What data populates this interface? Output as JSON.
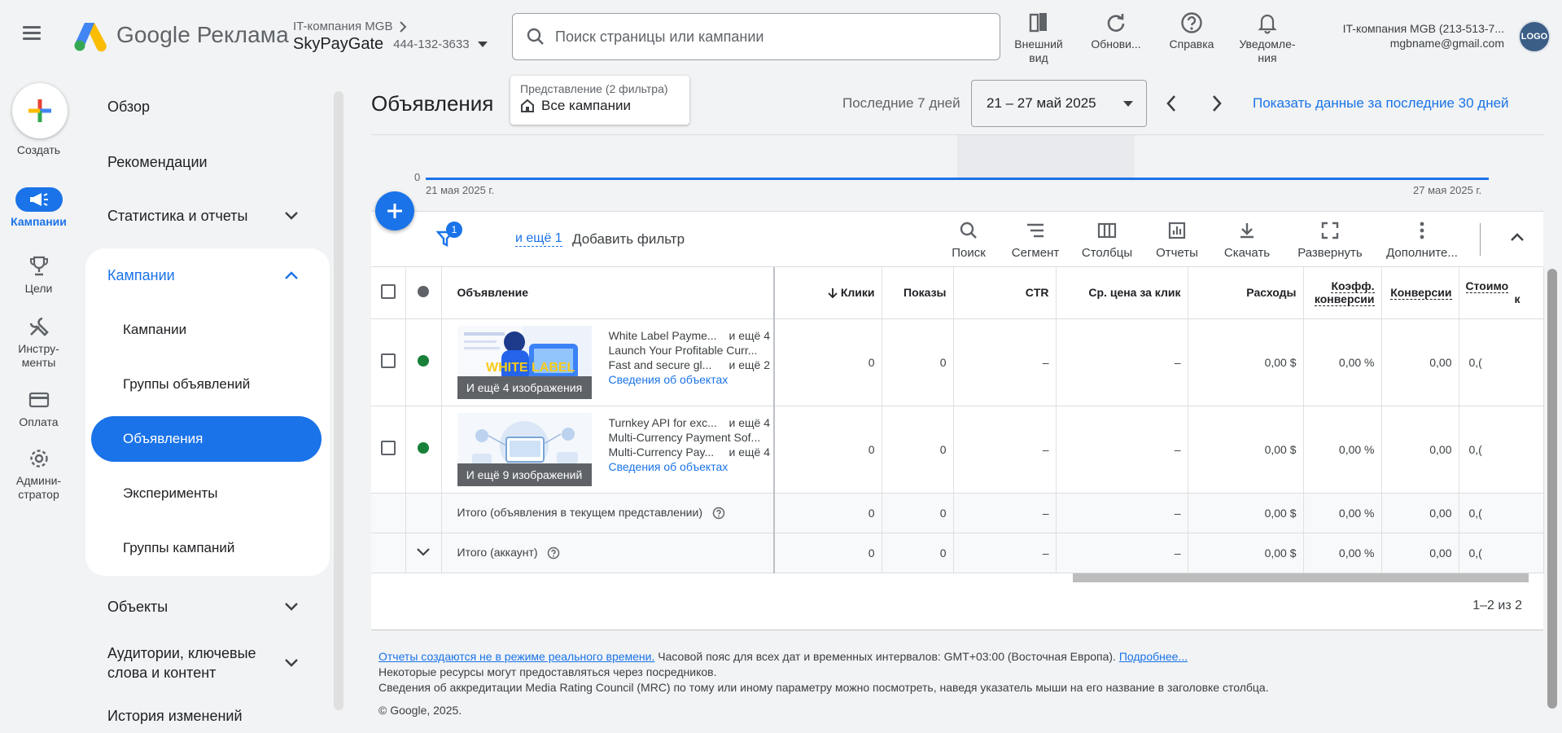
{
  "header": {
    "product": "Google Реклама",
    "account_company": "IT-компания MGB",
    "account_name": "SkyPayGate",
    "account_id": "444-132-3633",
    "search_placeholder": "Поиск страницы или кампании",
    "tools": [
      {
        "label1": "Внешний",
        "label2": "вид",
        "icon": "appearance-icon"
      },
      {
        "label1": "Обнови...",
        "label2": "",
        "icon": "refresh-icon"
      },
      {
        "label1": "Справка",
        "label2": "",
        "icon": "help-icon"
      },
      {
        "label1": "Уведомле-",
        "label2": "ния",
        "icon": "bell-icon"
      }
    ],
    "user_line1": "IT-компания MGB (213-513-7...",
    "user_line2": "mgbname@gmail.com",
    "avatar_text": "LOGO"
  },
  "rail": {
    "create": "Создать",
    "items": [
      {
        "label1": "Кампании",
        "label2": "",
        "icon": "campaign-icon",
        "active": true
      },
      {
        "label1": "Цели",
        "label2": "",
        "icon": "trophy-icon",
        "active": false
      },
      {
        "label1": "Инстру-",
        "label2": "менты",
        "icon": "tools-icon",
        "active": false
      },
      {
        "label1": "Оплата",
        "label2": "",
        "icon": "card-icon",
        "active": false
      },
      {
        "label1": "Админи-",
        "label2": "стратор",
        "icon": "gear-icon",
        "active": false
      }
    ]
  },
  "sidenav": {
    "overview": "Обзор",
    "recommendations": "Рекомендации",
    "stats": "Статистика и отчеты",
    "campaigns_group": "Кампании",
    "sub": [
      "Кампании",
      "Группы объявлений",
      "Объявления",
      "Эксперименты",
      "Группы кампаний"
    ],
    "objects": "Объекты",
    "audiences_line1": "Аудитории, ключевые",
    "audiences_line2": "слова и контент",
    "history": "История изменений"
  },
  "main": {
    "title": "Объявления",
    "view_label": "Представление (2 фильтра)",
    "view_value": "Все кампании",
    "date_label": "Последние 7 дней",
    "date_range": "21 – 27 май 2025",
    "last30": "Показать данные за последние 30 дней"
  },
  "chart_data": {
    "type": "line",
    "x": [
      "21 мая 2025 г.",
      "27 мая 2025 г."
    ],
    "series": [
      {
        "values": [
          0,
          0
        ]
      }
    ],
    "ytick": "0"
  },
  "toolbar": {
    "filter_count": "1",
    "and_more": "и ещё 1",
    "add_filter": "Добавить фильтр",
    "buttons": [
      {
        "label": "Поиск",
        "icon": "search-icon"
      },
      {
        "label": "Сегмент",
        "icon": "segment-icon"
      },
      {
        "label": "Столбцы",
        "icon": "columns-icon"
      },
      {
        "label": "Отчеты",
        "icon": "reports-icon"
      },
      {
        "label": "Скачать",
        "icon": "download-icon"
      },
      {
        "label": "Развернуть",
        "icon": "expand-icon"
      },
      {
        "label": "Дополните...",
        "icon": "more-vert-icon"
      }
    ]
  },
  "table": {
    "headers": {
      "ad": "Объявление",
      "clicks": "Клики",
      "impressions": "Показы",
      "ctr": "CTR",
      "avg_cpc": "Ср. цена за клик",
      "cost": "Расходы",
      "conv_rate_1": "Коэфф.",
      "conv_rate_2": "конверсии",
      "conversions": "Конверсии",
      "cost_conv_1": "Стоимо",
      "cost_conv_2": "к"
    },
    "rows": [
      {
        "images_more": "И ещё 4 изображения",
        "line1": "White Label Payme...",
        "line1_more": "и ещё 4",
        "line2": "Launch Your Profitable Curr...",
        "line3": "Fast and secure gl...",
        "line3_more": "и ещё 2",
        "details": "Сведения об объектах",
        "thumb_text": "WHITE LABEL",
        "clicks": "0",
        "impressions": "0",
        "ctr": "–",
        "cpc": "–",
        "cost": "0,00 $",
        "conv_rate": "0,00 %",
        "conversions": "0,00",
        "cost_conv": "0,("
      },
      {
        "images_more": "И ещё 9 изображений",
        "line1": "Turnkey API for exc...",
        "line1_more": "и ещё 4",
        "line2": "Multi-Currency Payment Sof...",
        "line3": "Multi-Currency Pay...",
        "line3_more": "и ещё 4",
        "details": "Сведения об объектах",
        "thumb_text": "",
        "clicks": "0",
        "impressions": "0",
        "ctr": "–",
        "cpc": "–",
        "cost": "0,00 $",
        "conv_rate": "0,00 %",
        "conversions": "0,00",
        "cost_conv": "0,("
      }
    ],
    "total_view": {
      "label": "Итого (объявления в текущем представлении)",
      "clicks": "0",
      "impressions": "0",
      "ctr": "–",
      "cpc": "–",
      "cost": "0,00 $",
      "conv_rate": "0,00 %",
      "conversions": "0,00",
      "cost_conv": "0,("
    },
    "total_account": {
      "label": "Итого (аккаунт)",
      "clicks": "0",
      "impressions": "0",
      "ctr": "–",
      "cpc": "–",
      "cost": "0,00 $",
      "conv_rate": "0,00 %",
      "conversions": "0,00",
      "cost_conv": "0,("
    },
    "pager": "1–2 из 2"
  },
  "footer": {
    "link1": "Отчеты создаются не в режиме реального времени.",
    "tz": " Часовой пояс для всех дат и временных интервалов: GMT+03:00 (Восточная Европа).",
    "link2": "Подробнее...",
    "line2": "Некоторые ресурсы могут предоставляться через посредников.",
    "line3": "Сведения об аккредитации Media Rating Council (MRC) по тому или иному параметру можно посмотреть, наведя указатель мыши на его название в заголовке столбца.",
    "copyright": "© Google, 2025."
  },
  "colors": {
    "accent": "#1a73e8",
    "status_ok": "#188038",
    "background": "#f1f3f4"
  }
}
